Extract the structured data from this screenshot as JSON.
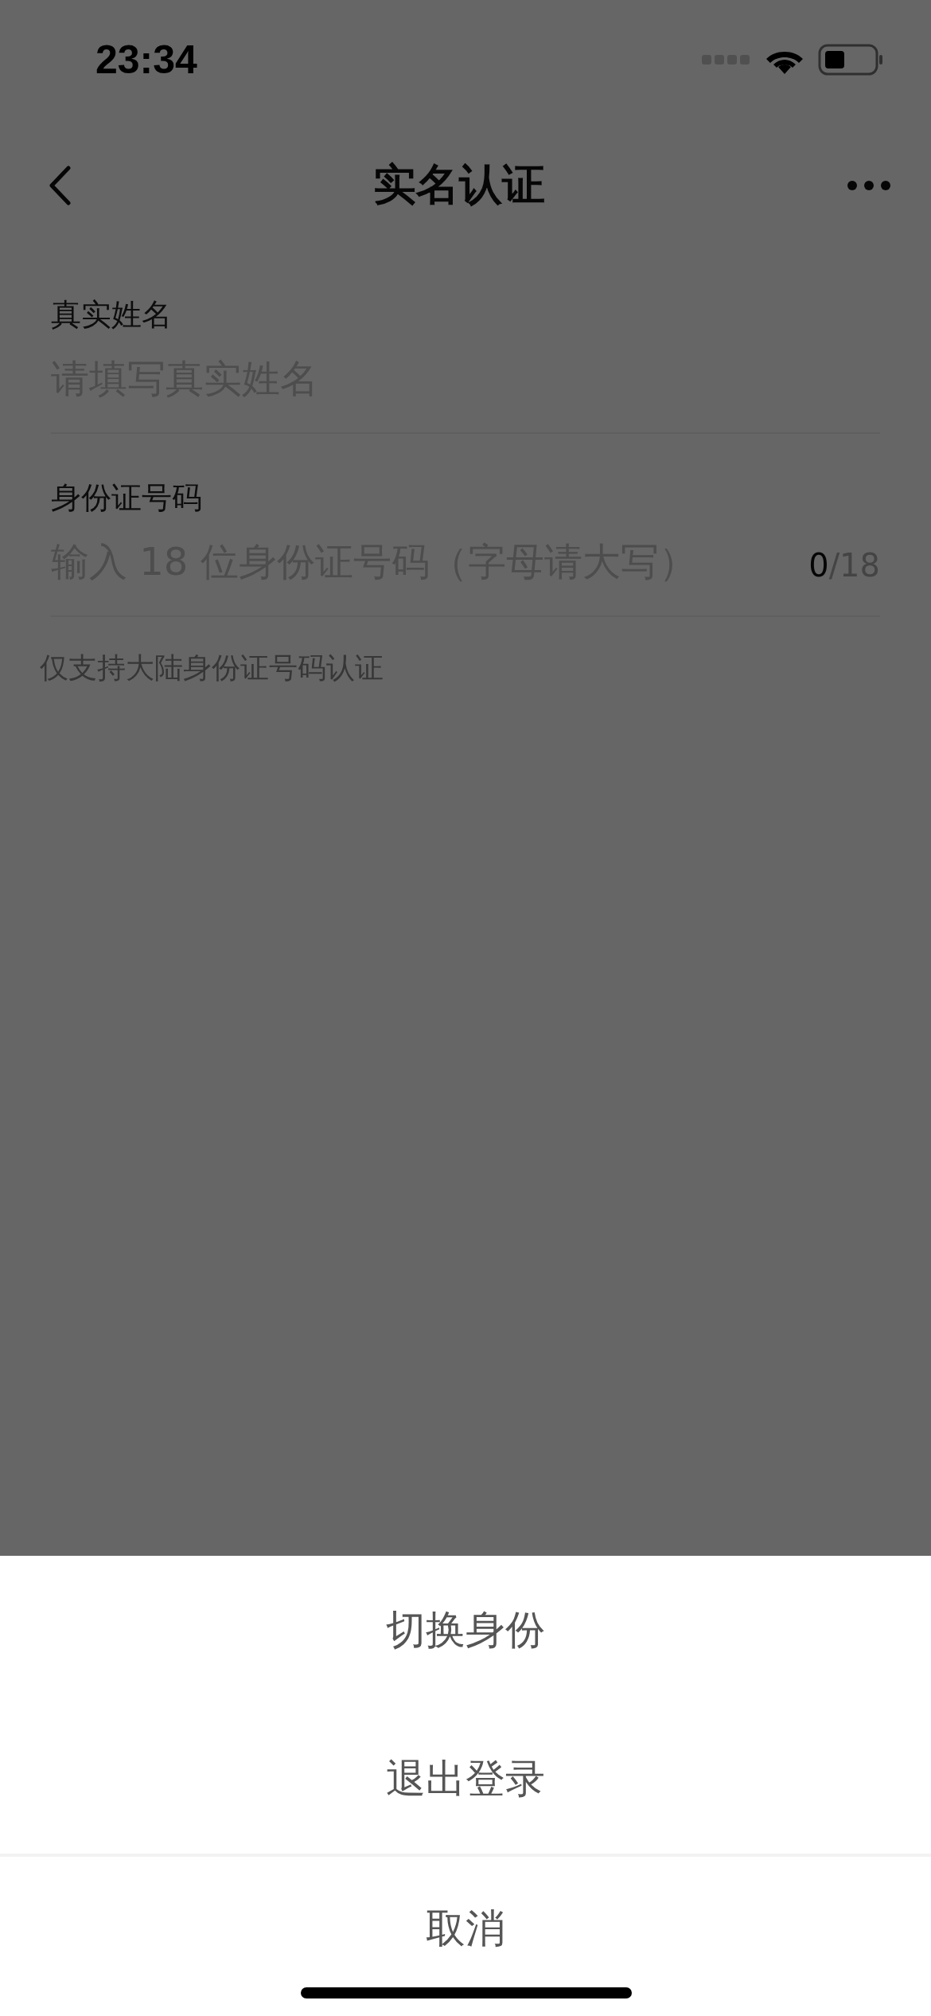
{
  "status_bar": {
    "time": "23:34"
  },
  "nav": {
    "title": "实名认证"
  },
  "fields": [
    {
      "label": "真实姓名",
      "placeholder": "请填写真实姓名"
    },
    {
      "label": "身份证号码",
      "placeholder": "输入 18 位身份证号码（字母请大写）",
      "counter": {
        "count": "0",
        "limit": "/18"
      }
    }
  ],
  "note": "仅支持大陆身份证号码认证",
  "action_sheet": {
    "actions": [
      "切换身份",
      "退出登录"
    ],
    "cancel": "取消"
  }
}
